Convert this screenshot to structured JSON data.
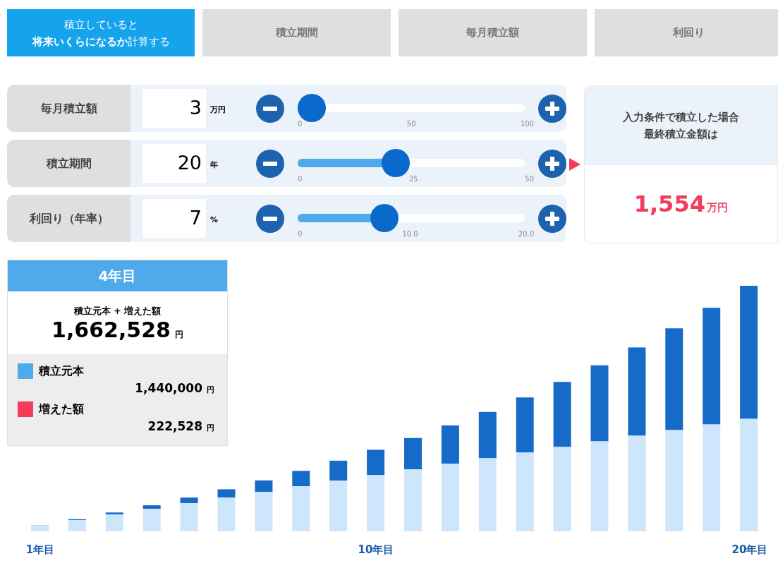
{
  "tabs": [
    {
      "lines": [
        "積立していると",
        "**将来いくらになるか**計算する"
      ],
      "selected": true
    },
    {
      "lines": [
        "積立期間"
      ],
      "selected": false
    },
    {
      "lines": [
        "毎月積立額"
      ],
      "selected": false
    },
    {
      "lines": [
        "利回り"
      ],
      "selected": false
    }
  ],
  "inputs": [
    {
      "label": "毎月積立額",
      "value": "3",
      "unit": "万円",
      "level": 0.03,
      "scale": [
        "0",
        "50",
        "100"
      ]
    },
    {
      "label": "積立期間",
      "value": "20",
      "unit": "年",
      "level": 0.4,
      "scale": [
        "0",
        "25",
        "50"
      ]
    },
    {
      "label": "利回り（年率）",
      "value": "7",
      "unit": "%",
      "level": 0.35,
      "scale": [
        "0",
        "10.0",
        "20.0"
      ]
    }
  ],
  "result": {
    "heading_lines": [
      "入力条件で積立した場合",
      "最終積立金額は"
    ],
    "amount": "1,554",
    "unit": "万円"
  },
  "tooltip": {
    "title": "4年目",
    "total_label": "積立元本 + 増えた額",
    "total": "1,662,528",
    "total_unit": "円",
    "legend": [
      {
        "label": "積立元本",
        "value": "1,440,000",
        "unit": "円",
        "color": "#4eaaea"
      },
      {
        "label": "増えた額",
        "value": "222,528",
        "unit": "円",
        "color": "#f43d5b"
      }
    ]
  },
  "chart": {
    "x_labels": [
      "1年目",
      "10年目",
      "20年目"
    ]
  }
}
